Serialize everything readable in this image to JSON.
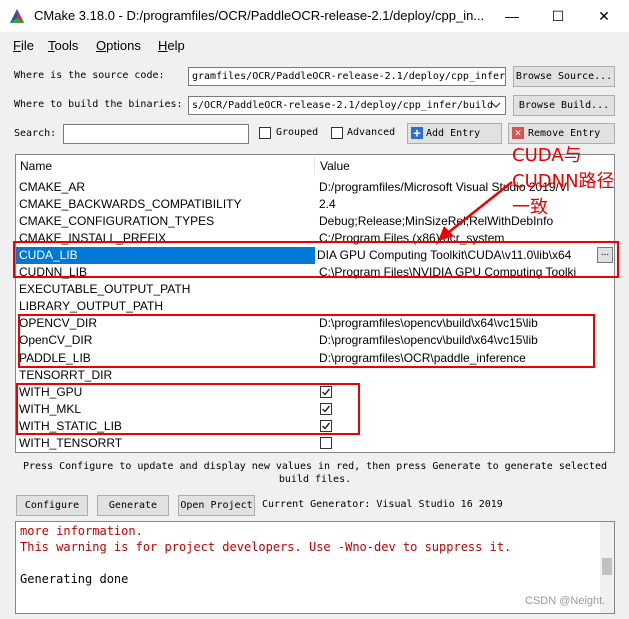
{
  "window": {
    "title": "CMake 3.18.0 - D:/programfiles/OCR/PaddleOCR-release-2.1/deploy/cpp_in...",
    "minimize_glyph": "—",
    "maximize_glyph": "☐",
    "close_glyph": "✕"
  },
  "menu": [
    {
      "u": "F",
      "rest": "ile"
    },
    {
      "u": "T",
      "rest": "ools"
    },
    {
      "u": "O",
      "rest": "ptions"
    },
    {
      "u": "H",
      "rest": "elp"
    }
  ],
  "source": {
    "label": "Where is the source code:",
    "value": "gramfiles/OCR/PaddleOCR-release-2.1/deploy/cpp_infer",
    "button": "Browse Source..."
  },
  "build": {
    "label": "Where to build the binaries:",
    "value": "s/OCR/PaddleOCR-release-2.1/deploy/cpp_infer/build",
    "button": "Browse Build..."
  },
  "search": {
    "label": "Search:",
    "value": ""
  },
  "options": {
    "grouped": "Grouped",
    "advanced": "Advanced",
    "add_entry": "Add Entry",
    "remove_entry": "Remove Entry"
  },
  "table": {
    "col_name": "Name",
    "col_value": "Value",
    "rows": [
      {
        "name": "CMAKE_AR",
        "value": "D:/programfiles/Microsoft Visual Studio 2019/Vi"
      },
      {
        "name": "CMAKE_BACKWARDS_COMPATIBILITY",
        "value": "2.4"
      },
      {
        "name": "CMAKE_CONFIGURATION_TYPES",
        "value": "Debug;Release;MinSizeRel;RelWithDebInfo"
      },
      {
        "name": "CMAKE_INSTALL_PREFIX",
        "value": "C:/Program Files (x86)/ocr_system"
      },
      {
        "name": "CUDA_LIB",
        "value": "DIA GPU Computing Toolkit\\CUDA\\v11.0\\lib\\x64"
      },
      {
        "name": "CUDNN_LIB",
        "value": "C:\\Program Files\\NVIDIA GPU Computing Toolki"
      },
      {
        "name": "EXECUTABLE_OUTPUT_PATH",
        "value": ""
      },
      {
        "name": "LIBRARY_OUTPUT_PATH",
        "value": ""
      },
      {
        "name": "OPENCV_DIR",
        "value": "D:\\programfiles\\opencv\\build\\x64\\vc15\\lib"
      },
      {
        "name": "OpenCV_DIR",
        "value": "D:\\programfiles\\opencv\\build\\x64\\vc15\\lib"
      },
      {
        "name": "PADDLE_LIB",
        "value": "D:\\programfiles\\OCR\\paddle_inference"
      },
      {
        "name": "TENSORRT_DIR",
        "value": ""
      },
      {
        "name": "WITH_GPU",
        "checked": true
      },
      {
        "name": "WITH_MKL",
        "checked": true
      },
      {
        "name": "WITH_STATIC_LIB",
        "checked": true
      },
      {
        "name": "WITH_TENSORRT",
        "checked": false
      }
    ],
    "edit_button": "..."
  },
  "annotation": "CUDA与CUDNN路径一致",
  "hint": "Press Configure to update and display new values in red, then press Generate to generate selected build files.",
  "buttons": {
    "configure": "Configure",
    "generate": "Generate",
    "open_project": "Open Project"
  },
  "generator": "Current Generator: Visual Studio 16 2019",
  "output": [
    {
      "text": "  more information.",
      "color": "#c00000"
    },
    {
      "text": "This warning is for project developers.  Use -Wno-dev to suppress it.",
      "color": "#c00000"
    },
    {
      "text": "",
      "color": "#000000"
    },
    {
      "text": "Generating done",
      "color": "#000000"
    }
  ],
  "watermark": "CSDN @Neight."
}
